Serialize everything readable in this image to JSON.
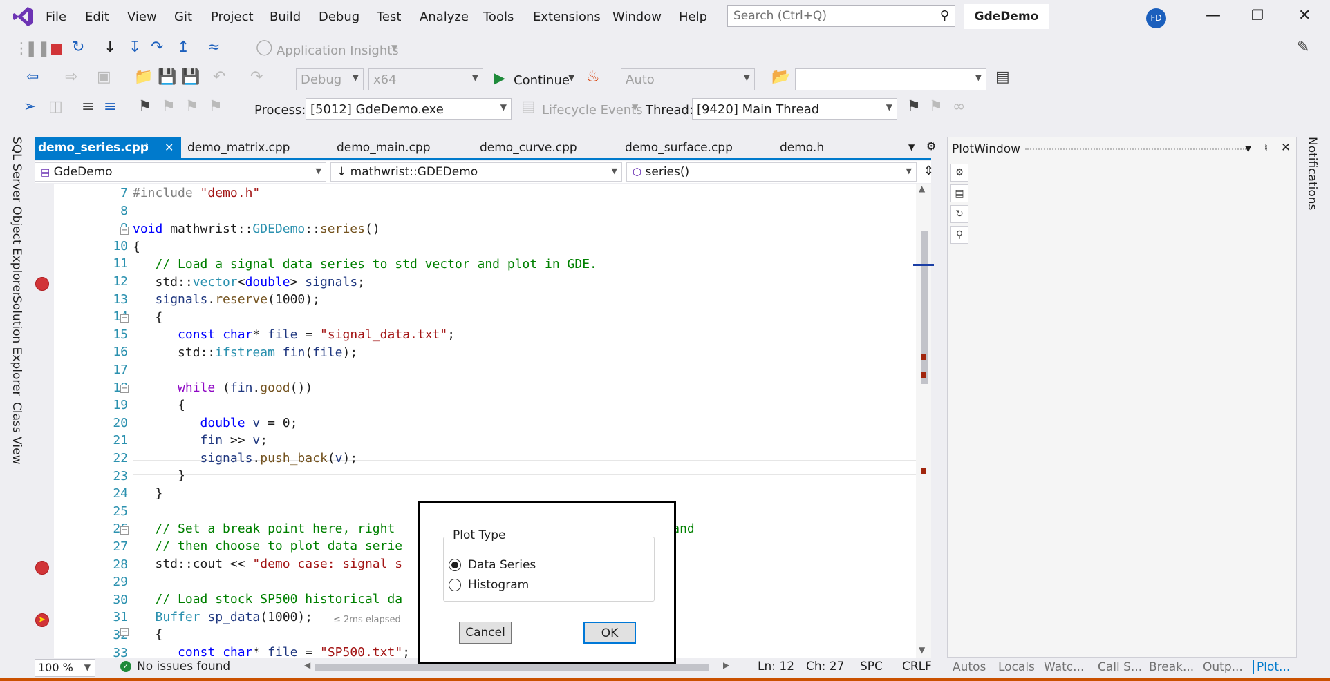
{
  "menu": [
    "File",
    "Edit",
    "View",
    "Git",
    "Project",
    "Build",
    "Debug",
    "Test",
    "Analyze",
    "Tools",
    "Extensions",
    "Window",
    "Help"
  ],
  "search": {
    "placeholder": "Search (Ctrl+Q)"
  },
  "solution_title": "GdeDemo",
  "user_initials": "FD",
  "toolbar1": {
    "app_insights": "Application Insights"
  },
  "toolbar2": {
    "config": "Debug",
    "platform": "x64",
    "continue": "Continue",
    "auto": "Auto"
  },
  "toolbar3": {
    "process_label": "Process:",
    "process": "[5012] GdeDemo.exe",
    "lifecycle": "Lifecycle Events",
    "thread_label": "Thread:",
    "thread": "[9420] Main Thread"
  },
  "side_tabs": [
    "SQL Server Object Explorer",
    "Solution Explorer",
    "Class View"
  ],
  "file_tabs": [
    "demo_series.cpp",
    "demo_matrix.cpp",
    "demo_main.cpp",
    "demo_curve.cpp",
    "demo_surface.cpp",
    "demo.h"
  ],
  "nav": {
    "project": "GdeDemo",
    "scope": "mathwrist::GDEDemo",
    "member": "series()"
  },
  "line_numbers": [
    "7",
    "8",
    "9",
    "10",
    "11",
    "12",
    "13",
    "14",
    "15",
    "16",
    "17",
    "18",
    "19",
    "20",
    "21",
    "22",
    "23",
    "24",
    "25",
    "26",
    "27",
    "28",
    "29",
    "30",
    "31",
    "32",
    "33"
  ],
  "elapsed": "≤ 2ms elapsed",
  "status": {
    "zoom": "100 %",
    "issues": "No issues found",
    "line": "Ln: 12",
    "col": "Ch: 27",
    "spc": "SPC",
    "eol": "CRLF"
  },
  "plot_window": {
    "title": "PlotWindow"
  },
  "bottom_tabs": [
    "Autos",
    "Locals",
    "Watc...",
    "Call S...",
    "Break...",
    "Outp...",
    "Plot..."
  ],
  "notifications": "Notifications",
  "dialog": {
    "group": "Plot Type",
    "option1": "Data Series",
    "option2": "Histogram",
    "cancel": "Cancel",
    "ok": "OK"
  },
  "colors": {
    "accent": "#007acc",
    "breakpoint": "#d13438",
    "comment": "#008000",
    "keyword": "#0000ff",
    "string": "#a31515"
  }
}
